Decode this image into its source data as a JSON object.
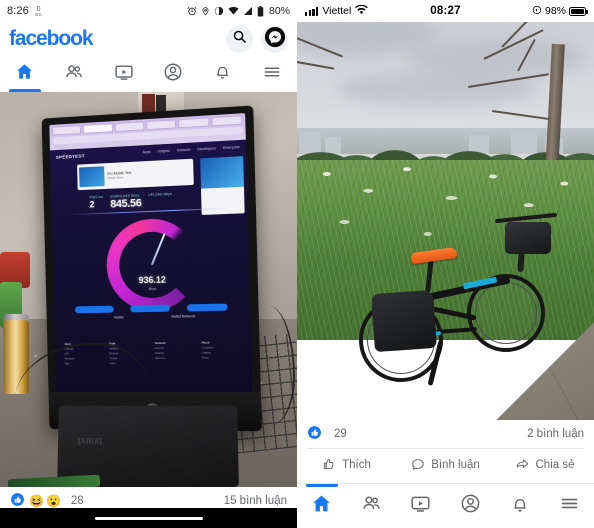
{
  "left_phone": {
    "platform": "android",
    "status_bar": {
      "time": "8:26",
      "notification_icon": "keyboard-icon",
      "icons": [
        "alarm-icon",
        "location-icon",
        "dnd-icon",
        "wifi-icon",
        "signal-icon",
        "battery-icon"
      ],
      "battery_percent": "80%"
    },
    "app_header": {
      "logo_text": "facebook",
      "logo_color": "#1877F2",
      "search_icon": "search-icon",
      "messenger_icon": "messenger-icon"
    },
    "nav_tabs": [
      {
        "name": "home",
        "icon": "home-icon",
        "active": true
      },
      {
        "name": "friends",
        "icon": "friends-icon",
        "active": false
      },
      {
        "name": "watch",
        "icon": "watch-video-icon",
        "active": false
      },
      {
        "name": "profile",
        "icon": "profile-icon",
        "active": false
      },
      {
        "name": "notifications",
        "icon": "bell-icon",
        "active": false
      },
      {
        "name": "menu",
        "icon": "hamburger-menu-icon",
        "active": false
      }
    ],
    "post": {
      "photo_description": "Monitor on a desk displaying a Speedtest result page",
      "speedtest": {
        "brand": "SPEEDTEST",
        "menu": [
          "Apps",
          "Insights",
          "Network",
          "Developers",
          "Enterprise"
        ],
        "ping_label": "PING ms",
        "ping_value": "2",
        "download_label": "DOWNLOAD Mbps",
        "download_value": "845.56",
        "upload_label": "UPLOAD Mbps",
        "gauge_value": "936.12",
        "gauge_unit": "Mbps",
        "isp_left": "Viettel",
        "isp_right": "Viettel Network"
      },
      "reactions": {
        "icons": [
          "like-reaction",
          "haha-reaction",
          "wow-reaction"
        ],
        "count": "28"
      },
      "comments_text": "15 bình luận"
    },
    "nav_bar": {
      "gesture_pill": true
    }
  },
  "right_phone": {
    "platform": "ios",
    "status_bar": {
      "signal_icon": "cellular-signal-icon",
      "carrier": "Viettel",
      "wifi_icon": "wifi-icon",
      "time": "08:27",
      "lock_rotation_icon": "rotation-lock-icon",
      "battery_percent": "98%",
      "battery_icon": "battery-icon"
    },
    "post": {
      "photo_description": "Folding bicycle with orange saddle parked beside a grassy field",
      "reactions": {
        "icons": [
          "like-reaction"
        ],
        "count": "29"
      },
      "comments_text": "2 bình luận"
    },
    "actions": [
      {
        "name": "like",
        "label": "Thích",
        "icon": "thumbs-up-icon"
      },
      {
        "name": "comment",
        "label": "Bình luận",
        "icon": "comment-bubble-icon"
      },
      {
        "name": "share",
        "label": "Chia sẻ",
        "icon": "share-arrow-icon"
      }
    ],
    "nav_tabs": [
      {
        "name": "home",
        "icon": "home-icon",
        "active": true
      },
      {
        "name": "friends",
        "icon": "friends-icon",
        "active": false
      },
      {
        "name": "watch",
        "icon": "watch-video-icon",
        "active": false
      },
      {
        "name": "profile",
        "icon": "profile-icon",
        "active": false
      },
      {
        "name": "notifications",
        "icon": "bell-icon",
        "active": false
      },
      {
        "name": "menu",
        "icon": "hamburger-menu-icon",
        "active": false
      }
    ]
  },
  "theme": {
    "fb_blue": "#1877F2",
    "text_secondary": "#65676B",
    "divider": "#E4E6EB"
  }
}
